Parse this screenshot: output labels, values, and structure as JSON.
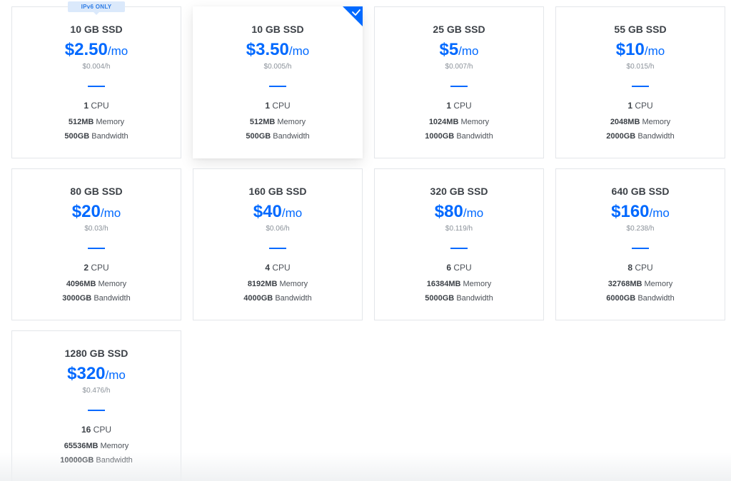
{
  "colors": {
    "accent": "#0069ff",
    "badge_bg": "#dbe9fb",
    "border": "#e3e6ea",
    "text": "#3c4147",
    "muted": "#8a9199"
  },
  "badge": {
    "label": "IPv6 ONLY"
  },
  "selected_icon": "checkmark-icon",
  "plans": [
    {
      "size": "10 GB SSD",
      "price": "$2.50",
      "per": "/mo",
      "hourly": "$0.004/h",
      "cpu_count": "1",
      "cpu_label": "CPU",
      "memory_value": "512MB",
      "memory_label": "Memory",
      "bandwidth_value": "500GB",
      "bandwidth_label": "Bandwidth"
    },
    {
      "size": "10 GB SSD",
      "price": "$3.50",
      "per": "/mo",
      "hourly": "$0.005/h",
      "cpu_count": "1",
      "cpu_label": "CPU",
      "memory_value": "512MB",
      "memory_label": "Memory",
      "bandwidth_value": "500GB",
      "bandwidth_label": "Bandwidth"
    },
    {
      "size": "25 GB SSD",
      "price": "$5",
      "per": "/mo",
      "hourly": "$0.007/h",
      "cpu_count": "1",
      "cpu_label": "CPU",
      "memory_value": "1024MB",
      "memory_label": "Memory",
      "bandwidth_value": "1000GB",
      "bandwidth_label": "Bandwidth"
    },
    {
      "size": "55 GB SSD",
      "price": "$10",
      "per": "/mo",
      "hourly": "$0.015/h",
      "cpu_count": "1",
      "cpu_label": "CPU",
      "memory_value": "2048MB",
      "memory_label": "Memory",
      "bandwidth_value": "2000GB",
      "bandwidth_label": "Bandwidth"
    },
    {
      "size": "80 GB SSD",
      "price": "$20",
      "per": "/mo",
      "hourly": "$0.03/h",
      "cpu_count": "2",
      "cpu_label": "CPU",
      "memory_value": "4096MB",
      "memory_label": "Memory",
      "bandwidth_value": "3000GB",
      "bandwidth_label": "Bandwidth"
    },
    {
      "size": "160 GB SSD",
      "price": "$40",
      "per": "/mo",
      "hourly": "$0.06/h",
      "cpu_count": "4",
      "cpu_label": "CPU",
      "memory_value": "8192MB",
      "memory_label": "Memory",
      "bandwidth_value": "4000GB",
      "bandwidth_label": "Bandwidth"
    },
    {
      "size": "320 GB SSD",
      "price": "$80",
      "per": "/mo",
      "hourly": "$0.119/h",
      "cpu_count": "6",
      "cpu_label": "CPU",
      "memory_value": "16384MB",
      "memory_label": "Memory",
      "bandwidth_value": "5000GB",
      "bandwidth_label": "Bandwidth"
    },
    {
      "size": "640 GB SSD",
      "price": "$160",
      "per": "/mo",
      "hourly": "$0.238/h",
      "cpu_count": "8",
      "cpu_label": "CPU",
      "memory_value": "32768MB",
      "memory_label": "Memory",
      "bandwidth_value": "6000GB",
      "bandwidth_label": "Bandwidth"
    },
    {
      "size": "1280 GB SSD",
      "price": "$320",
      "per": "/mo",
      "hourly": "$0.476/h",
      "cpu_count": "16",
      "cpu_label": "CPU",
      "memory_value": "65536MB",
      "memory_label": "Memory",
      "bandwidth_value": "10000GB",
      "bandwidth_label": "Bandwidth"
    }
  ]
}
